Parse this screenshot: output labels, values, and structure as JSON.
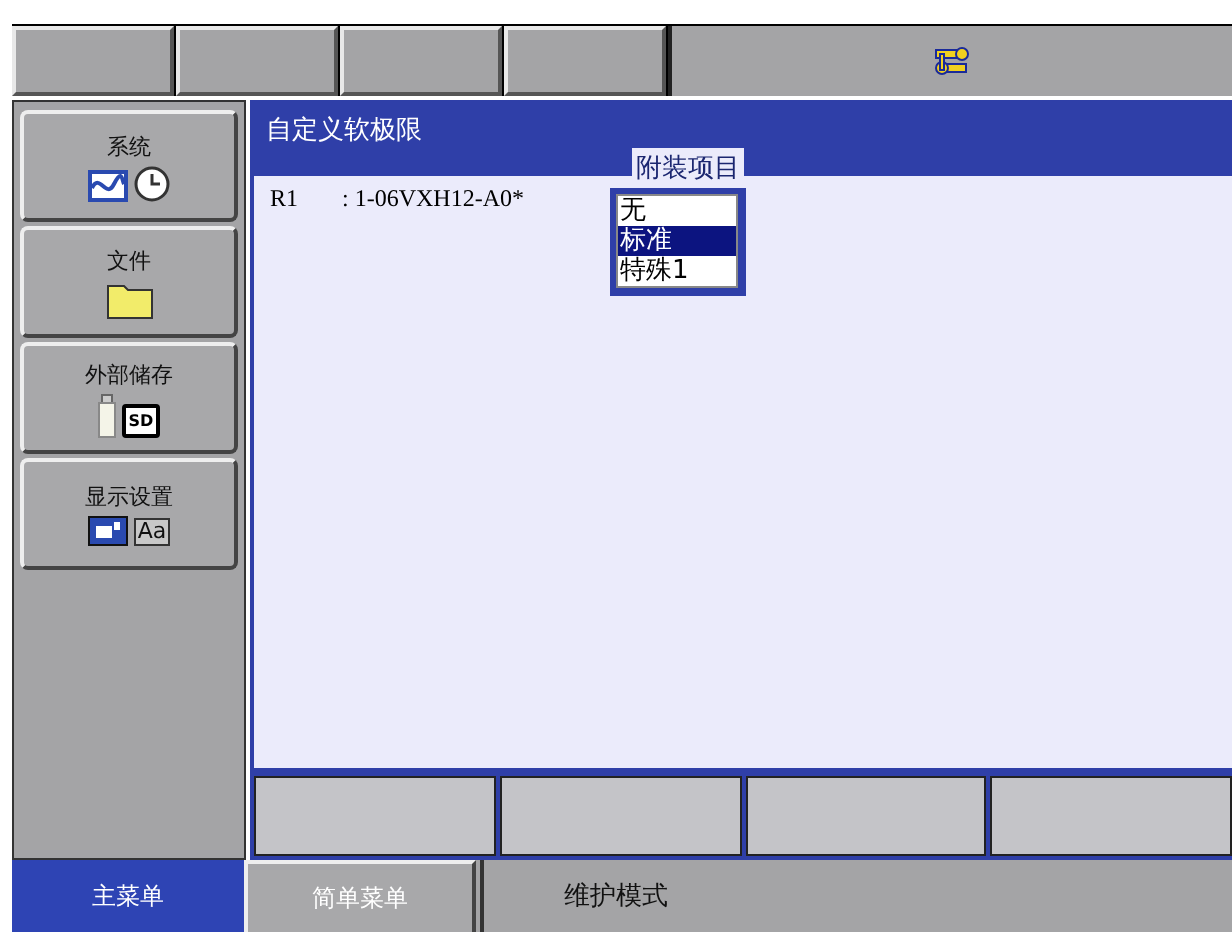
{
  "sidebar": {
    "items": [
      {
        "label": "系统",
        "kind": "system"
      },
      {
        "label": "文件",
        "kind": "file"
      },
      {
        "label": "外部储存",
        "kind": "storage",
        "icon_text": "SD"
      },
      {
        "label": "显示设置",
        "kind": "display",
        "icon_text": "Aa"
      }
    ]
  },
  "panel": {
    "title": "自定义软极限",
    "rows": [
      {
        "label": "R1",
        "value": ": 1-06VXH12-A0*"
      }
    ]
  },
  "popup": {
    "title": "附装项目",
    "options": [
      {
        "label": "无",
        "selected": false
      },
      {
        "label": "标准",
        "selected": true
      },
      {
        "label": "特殊1",
        "selected": false
      }
    ]
  },
  "bottom_bar": {
    "tabs": [
      {
        "label": "主菜单",
        "selected": true
      },
      {
        "label": "简单菜单",
        "selected": false
      }
    ],
    "status": "维护模式"
  }
}
